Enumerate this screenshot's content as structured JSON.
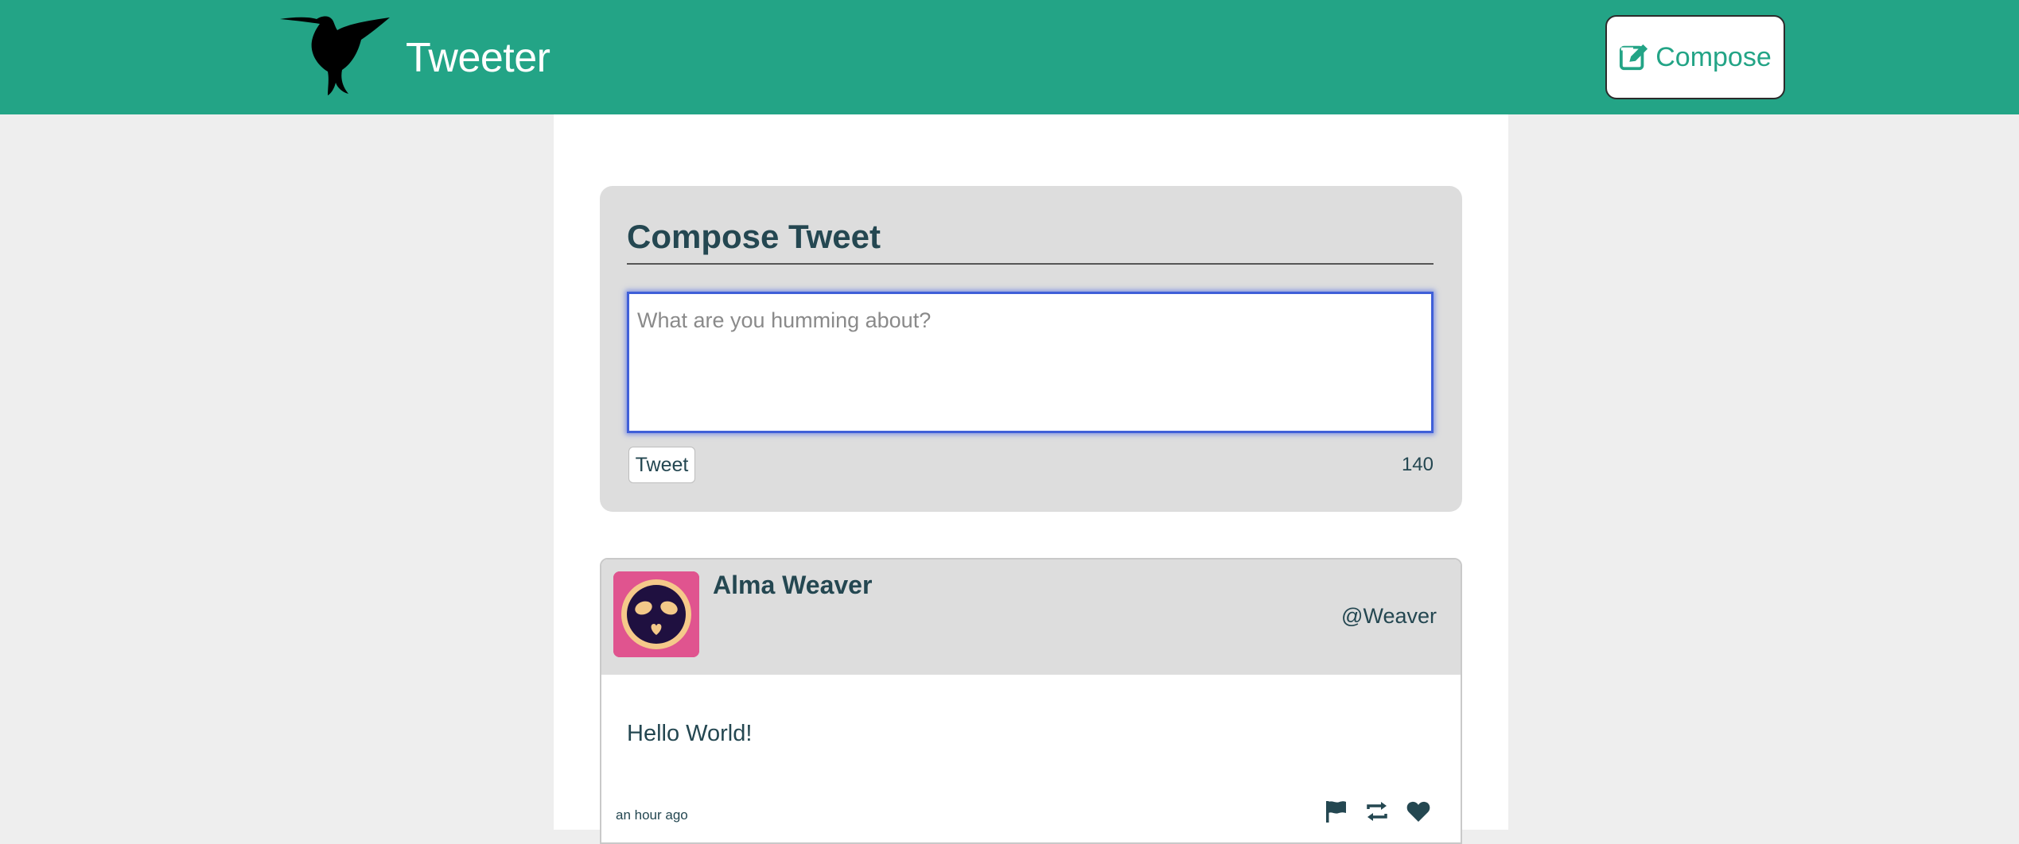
{
  "header": {
    "brand": "Tweeter",
    "logo_icon": "hummingbird-icon",
    "compose_label": "Compose",
    "compose_icon": "edit-icon"
  },
  "compose": {
    "title": "Compose Tweet",
    "placeholder": "What are you humming about?",
    "value": "",
    "submit_label": "Tweet",
    "counter": "140"
  },
  "tweets": [
    {
      "name": "Alma Weaver",
      "handle": "@Weaver",
      "content": "Hello World!",
      "time": "an hour ago",
      "actions": [
        "flag-icon",
        "retweet-icon",
        "heart-icon"
      ]
    }
  ],
  "colors": {
    "brand": "#23a486",
    "text": "#244751",
    "card": "#dddddd",
    "page_bg": "#eeeeee",
    "focus": "#3f5fd8",
    "avatar_bg": "#e0548f"
  }
}
